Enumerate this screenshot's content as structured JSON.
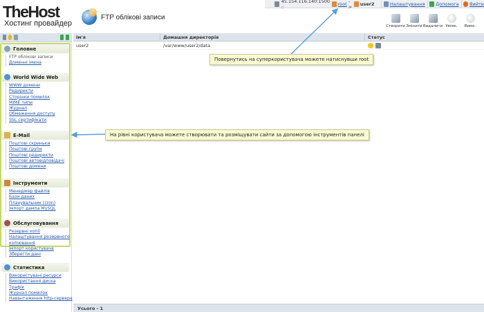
{
  "logo": {
    "brand": "TheHost",
    "tagline": "Хостинг провайдер"
  },
  "page_title": "FTP облікові записи",
  "topbar": {
    "ip": "45.154.116.140:1500 ::",
    "root": "root",
    "arrow": "->",
    "user": "user2",
    "settings": "Налаштування",
    "help": "Допомога",
    "logout": "Вийти"
  },
  "toolbar": {
    "create": "Створити",
    "edit": "Змінити",
    "delete": "Видалити",
    "on": "Увімк.",
    "off": "Вимк."
  },
  "sidebar": {
    "groups": [
      {
        "title": "Головне",
        "items": [
          "FTP облікові записи",
          "Доменні імена"
        ]
      },
      {
        "title": "World Wide Web",
        "items": [
          "WWW домени",
          "Редиректи",
          "Сторінки помилок",
          "MIME типи",
          "Журнал",
          "Обмеження доступу",
          "SSL сертифікати"
        ]
      },
      {
        "title": "E-Mail",
        "items": [
          "Поштові скриньки",
          "Поштові групи",
          "Поштові редиректи",
          "Поштові автовідповідачі",
          "Поштові домени"
        ]
      },
      {
        "title": "Інструменти",
        "items": [
          "Менеджер файлів",
          "Бази даних",
          "Планувальник (cron)",
          "Імпорт дампа MySQL"
        ]
      },
      {
        "title": "Обслуговування",
        "items": [
          "Резервні копії",
          "Налаштування резервного",
          "копіювання",
          "Імпорт користувача",
          "Зберегти дані"
        ]
      },
      {
        "title": "Статистика",
        "items": [
          "Використувані ресурси",
          "Використання диска",
          "Трафік",
          "Журнал помилок",
          "Навантаження http-сервера"
        ]
      }
    ]
  },
  "grid": {
    "columns": [
      "Ім'я",
      "Домашня директорія",
      "Статус"
    ],
    "rows": [
      {
        "name": "user2",
        "home": "/var/www/user2/data"
      }
    ],
    "footer": "Усього - 1"
  },
  "callouts": {
    "root_hint": "Повернутись на суперкористувача можете натиснувши root",
    "panel_hint": "На рівні користувача можете створювати та розміщувати сайти за допомогою інструментів панелі"
  }
}
